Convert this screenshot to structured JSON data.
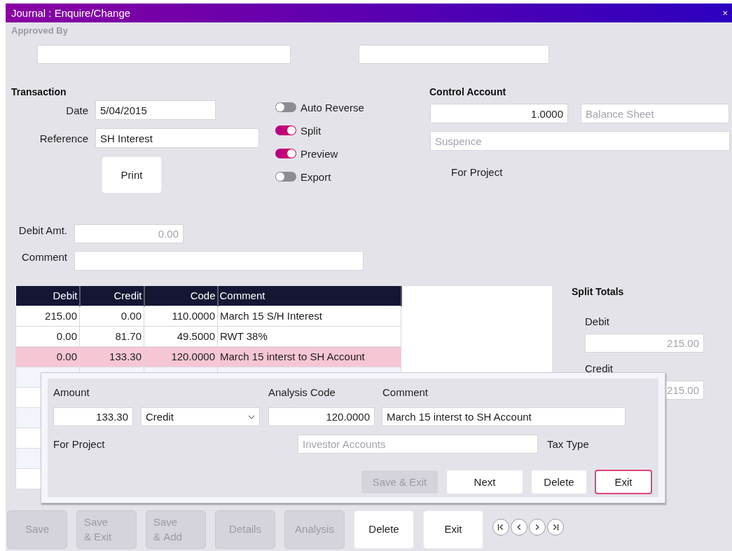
{
  "window": {
    "title": "Journal : Enquire/Change",
    "close": "×"
  },
  "approved_by": {
    "label": "Approved By"
  },
  "transaction": {
    "heading": "Transaction",
    "date": {
      "label": "Date",
      "value": "5/04/2015"
    },
    "reference": {
      "label": "Reference",
      "value": "SH Interest"
    },
    "print_button": "Print"
  },
  "toggles": [
    {
      "label": "Auto Reverse",
      "on": false
    },
    {
      "label": "Split",
      "on": true
    },
    {
      "label": "Preview",
      "on": true
    },
    {
      "label": "Export",
      "on": false
    }
  ],
  "control_account": {
    "heading": "Control Account",
    "code": "1.0000",
    "type": "Balance Sheet",
    "name": "Suspence",
    "for_project_label": "For Project"
  },
  "debit_amt": {
    "label": "Debit Amt.",
    "value": "0.00"
  },
  "comment": {
    "label": "Comment"
  },
  "table": {
    "columns": [
      "Debit",
      "Credit",
      "Code",
      "Comment"
    ],
    "rows": [
      {
        "cells": [
          "215.00",
          "0.00",
          "110.0000",
          "March 15 S/H Interest"
        ],
        "selected": false
      },
      {
        "cells": [
          "0.00",
          "81.70",
          "49.5000",
          "RWT 38%"
        ],
        "selected": false
      },
      {
        "cells": [
          "0.00",
          "133.30",
          "120.0000",
          "March 15 interst to SH Account"
        ],
        "selected": true
      }
    ]
  },
  "split_totals": {
    "heading": "Split Totals",
    "debit": {
      "label": "Debit",
      "value": "215.00"
    },
    "credit": {
      "label": "Credit",
      "value": "215.00"
    }
  },
  "edit_panel": {
    "amount_label": "Amount",
    "amount": "133.30",
    "side": "Credit",
    "analysis_code_label": "Analysis Code",
    "analysis_code": "120.0000",
    "comment_label": "Comment",
    "comment": "March 15 interst to SH Account",
    "for_project_label": "For Project",
    "project": "Investor Accounts",
    "tax_type_label": "Tax Type",
    "buttons": [
      {
        "label": "Save & Exit",
        "disabled": true,
        "focused": false
      },
      {
        "label": "Next",
        "disabled": false,
        "focused": false
      },
      {
        "label": "Delete",
        "disabled": false,
        "focused": false
      },
      {
        "label": "Exit",
        "disabled": false,
        "focused": true
      }
    ]
  },
  "buttons": [
    {
      "label": "Save",
      "disabled": true
    },
    {
      "label": "Save & Exit",
      "disabled": true
    },
    {
      "label": "Save & Add",
      "disabled": true
    },
    {
      "label": "Details",
      "disabled": true
    },
    {
      "label": "Analysis",
      "disabled": true
    },
    {
      "label": "Delete",
      "disabled": false
    },
    {
      "label": "Exit",
      "disabled": false
    }
  ],
  "navigation": [
    {
      "kind": "first"
    },
    {
      "kind": "previous"
    },
    {
      "kind": "next"
    },
    {
      "kind": "last"
    }
  ]
}
